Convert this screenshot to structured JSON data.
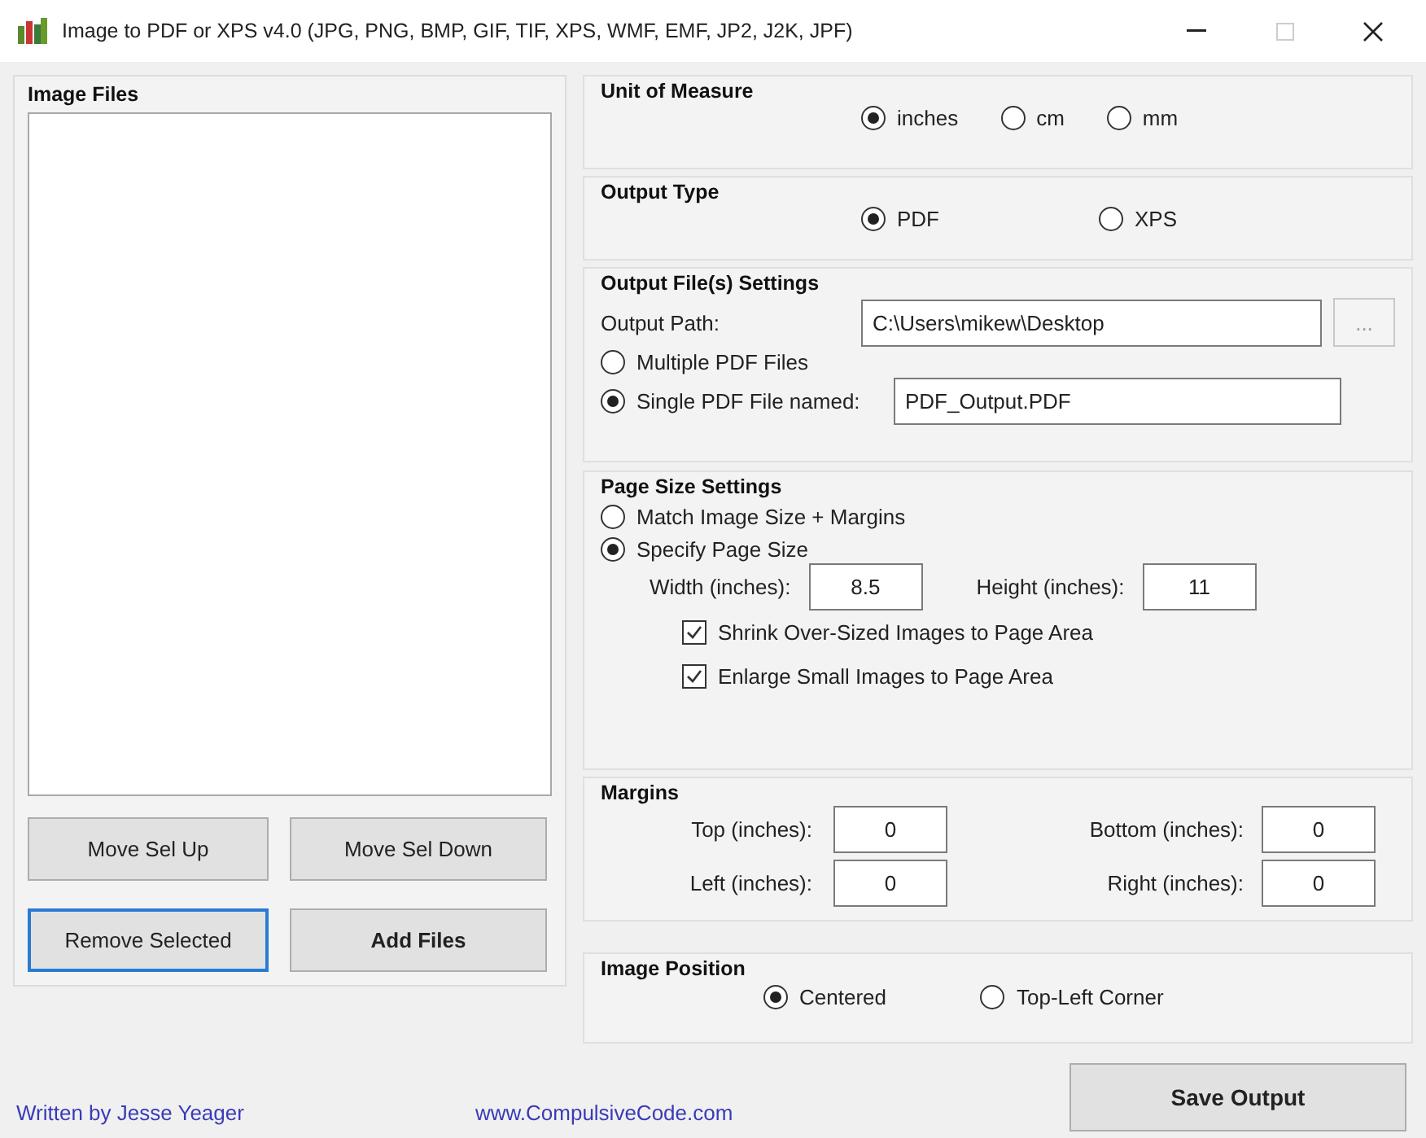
{
  "window": {
    "title": "Image to PDF or XPS  v4.0  (JPG, PNG, BMP, GIF, TIF, XPS, WMF, EMF, JP2, J2K, JPF)"
  },
  "image_files": {
    "title": "Image Files",
    "buttons": [
      {
        "label": "Move Sel Up",
        "focused": false,
        "bold": false
      },
      {
        "label": "Move Sel Down",
        "focused": false,
        "bold": false
      },
      {
        "label": "Remove Selected",
        "focused": true,
        "bold": false
      },
      {
        "label": "Add Files",
        "focused": false,
        "bold": true
      }
    ]
  },
  "unit_of_measure": {
    "title": "Unit of Measure",
    "options": [
      {
        "label": "inches",
        "selected": true
      },
      {
        "label": "cm",
        "selected": false
      },
      {
        "label": "mm",
        "selected": false
      }
    ]
  },
  "output_type": {
    "title": "Output Type",
    "options": [
      {
        "label": "PDF",
        "selected": true
      },
      {
        "label": "XPS",
        "selected": false
      }
    ]
  },
  "output_files": {
    "title": "Output File(s) Settings",
    "path_label": "Output Path:",
    "path_value": "C:\\Users\\mikew\\Desktop",
    "browse_button": "...",
    "modes": [
      {
        "label": "Multiple PDF Files",
        "selected": false
      },
      {
        "label": "Single PDF File named:",
        "selected": true
      }
    ],
    "file_name": "PDF_Output.PDF"
  },
  "page_size": {
    "title": "Page Size Settings",
    "modes": [
      {
        "label": "Match Image Size + Margins",
        "selected": false
      },
      {
        "label": "Specify Page Size",
        "selected": true
      }
    ],
    "width_label": "Width (inches):",
    "width_value": "8.5",
    "height_label": "Height (inches):",
    "height_value": "11",
    "checkboxes": [
      {
        "label": "Shrink Over-Sized Images to Page Area",
        "checked": true
      },
      {
        "label": "Enlarge Small Images to Page Area",
        "checked": true
      }
    ]
  },
  "margins": {
    "title": "Margins",
    "fields": [
      {
        "label": "Top (inches):",
        "value": "0"
      },
      {
        "label": "Bottom (inches):",
        "value": "0"
      },
      {
        "label": "Left (inches):",
        "value": "0"
      },
      {
        "label": "Right (inches):",
        "value": "0"
      }
    ]
  },
  "image_position": {
    "title": "Image Position",
    "options": [
      {
        "label": "Centered",
        "selected": true
      },
      {
        "label": "Top-Left Corner",
        "selected": false
      }
    ]
  },
  "footer": {
    "author": "Written by Jesse Yeager",
    "website": "www.CompulsiveCode.com",
    "save_button": "Save Output"
  }
}
